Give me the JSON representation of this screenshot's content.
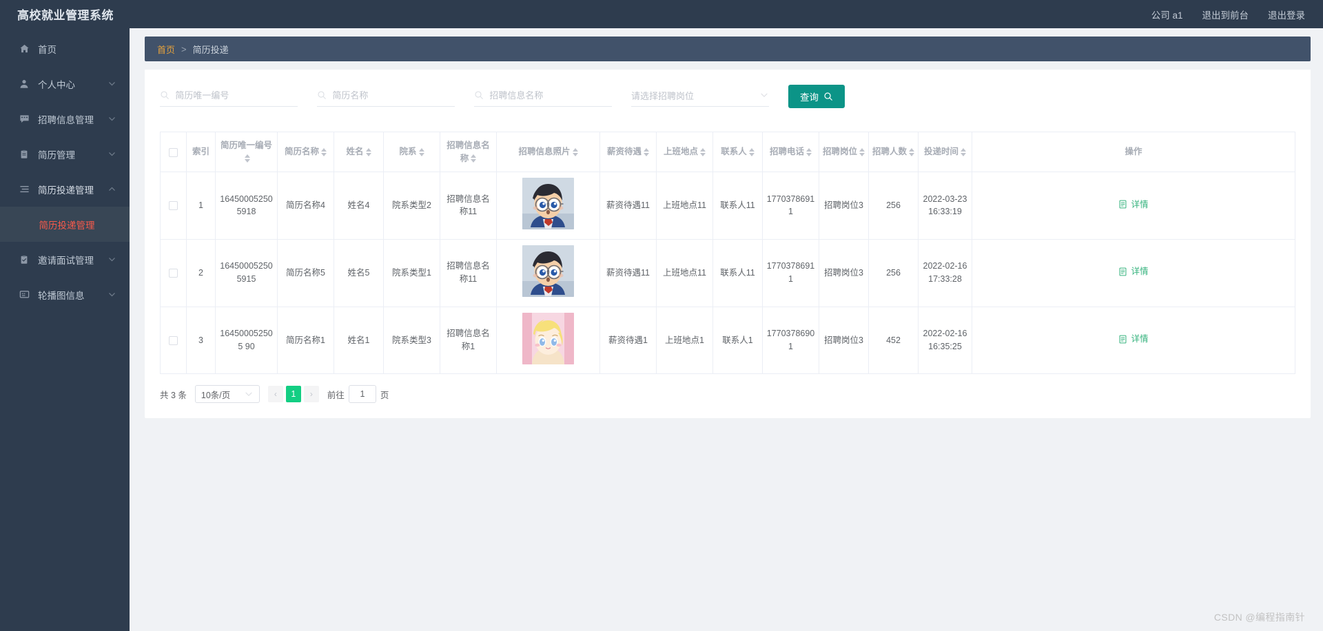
{
  "app": {
    "brand": "高校就业管理系统",
    "watermark": "CSDN @编程指南针"
  },
  "topbar": {
    "company": "公司 a1",
    "exit_front": "退出到前台",
    "logout": "退出登录"
  },
  "sidebar": {
    "items": [
      {
        "label": "首页",
        "icon": "home-icon",
        "has_chevron": false
      },
      {
        "label": "个人中心",
        "icon": "user-icon",
        "has_chevron": true
      },
      {
        "label": "招聘信息管理",
        "icon": "message-icon",
        "has_chevron": true
      },
      {
        "label": "简历管理",
        "icon": "clipboard-icon",
        "has_chevron": true
      },
      {
        "label": "简历投递管理",
        "icon": "list-icon",
        "has_chevron": true
      },
      {
        "label": "邀请面试管理",
        "icon": "clipboard-check-icon",
        "has_chevron": true
      },
      {
        "label": "轮播图信息",
        "icon": "image-icon",
        "has_chevron": true
      }
    ],
    "submenu": {
      "label": "简历投递管理",
      "active": true
    }
  },
  "breadcrumb": {
    "home": "首页",
    "separator": ">",
    "current": "简历投递"
  },
  "search": {
    "fields": [
      {
        "name": "resume-code",
        "placeholder": "简历唯一编号",
        "value": "",
        "icon": "search-icon"
      },
      {
        "name": "resume-name",
        "placeholder": "简历名称",
        "value": "",
        "icon": "search-icon"
      },
      {
        "name": "recruit-info-name",
        "placeholder": "招聘信息名称",
        "value": "",
        "icon": "search-icon"
      }
    ],
    "select": {
      "name": "recruit-post",
      "placeholder": "请选择招聘岗位",
      "value": ""
    },
    "query_button": "查询",
    "query_icon": "search-icon",
    "accent": "#0c9487"
  },
  "table": {
    "columns": [
      {
        "key": "checkbox",
        "label": "",
        "sortable": false
      },
      {
        "key": "index",
        "label": "索引",
        "sortable": false
      },
      {
        "key": "resume_code",
        "label": "简历唯一编号",
        "sortable": true
      },
      {
        "key": "resume_name",
        "label": "简历名称",
        "sortable": true
      },
      {
        "key": "person_name",
        "label": "姓名",
        "sortable": true
      },
      {
        "key": "department",
        "label": "院系",
        "sortable": true
      },
      {
        "key": "recruit_name",
        "label": "招聘信息名称",
        "sortable": true
      },
      {
        "key": "recruit_photo",
        "label": "招聘信息照片",
        "sortable": true
      },
      {
        "key": "salary",
        "label": "薪资待遇",
        "sortable": true
      },
      {
        "key": "work_place",
        "label": "上班地点",
        "sortable": true
      },
      {
        "key": "contact",
        "label": "联系人",
        "sortable": true
      },
      {
        "key": "phone",
        "label": "招聘电话",
        "sortable": true
      },
      {
        "key": "post",
        "label": "招聘岗位",
        "sortable": true
      },
      {
        "key": "headcount",
        "label": "招聘人数",
        "sortable": true
      },
      {
        "key": "submit_time",
        "label": "投递时间",
        "sortable": true
      },
      {
        "key": "action",
        "label": "操作",
        "sortable": false
      }
    ],
    "rows": [
      {
        "index": "1",
        "resume_code": "164500052505918",
        "resume_name": "简历名称4",
        "person_name": "姓名4",
        "department": "院系类型2",
        "recruit_name": "招聘信息名称11",
        "recruit_photo": "conan-avatar",
        "salary": "薪资待遇11",
        "work_place": "上班地点11",
        "contact": "联系人11",
        "phone": "17703786911",
        "post": "招聘岗位3",
        "headcount": "256",
        "submit_time": "2022-03-23 16:33:19",
        "action": "详情"
      },
      {
        "index": "2",
        "resume_code": "164500052505915",
        "resume_name": "简历名称5",
        "person_name": "姓名5",
        "department": "院系类型1",
        "recruit_name": "招聘信息名称11",
        "recruit_photo": "conan-avatar",
        "salary": "薪资待遇11",
        "work_place": "上班地点11",
        "contact": "联系人11",
        "phone": "17703786911",
        "post": "招聘岗位3",
        "headcount": "256",
        "submit_time": "2022-02-16 17:33:28",
        "action": "详情"
      },
      {
        "index": "3",
        "resume_code": "164500052505 90",
        "resume_name": "简历名称1",
        "person_name": "姓名1",
        "department": "院系类型3",
        "recruit_name": "招聘信息名称1",
        "recruit_photo": "pink-anime-avatar",
        "salary": "薪资待遇1",
        "work_place": "上班地点1",
        "contact": "联系人1",
        "phone": "17703786901",
        "post": "招聘岗位3",
        "headcount": "452",
        "submit_time": "2022-02-16 16:35:25",
        "action": "详情"
      }
    ]
  },
  "pagination": {
    "total_text": "共 3 条",
    "page_size": "10条/页",
    "prev": "‹",
    "next": "›",
    "current_page": "1",
    "jump_prefix": "前往",
    "jump_value": "1",
    "jump_suffix": "页",
    "active_color": "#13ce83"
  }
}
